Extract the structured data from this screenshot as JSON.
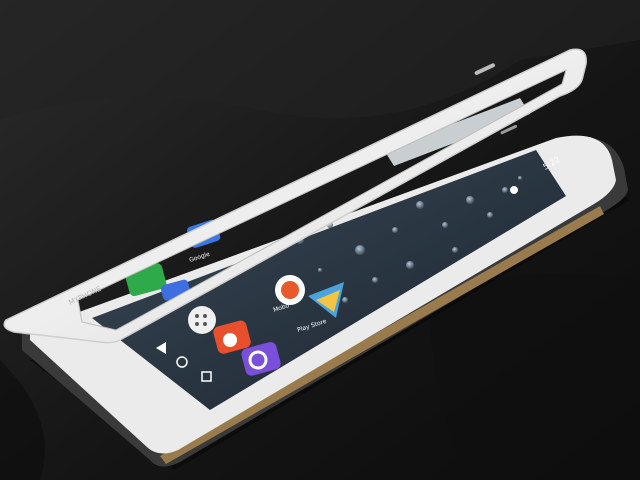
{
  "photo": {
    "subject": "smartphone with flip cover",
    "background_color": "#151515",
    "cover_color": "#f2f2f2",
    "body_color": "#e8e8e8",
    "bezel_color": "#2b2b2b",
    "screen_color": "#2a3440"
  },
  "screen": {
    "search_label": "Google",
    "status_time": "5:22",
    "apps": [
      {
        "name": "Google",
        "icon": "google-app-icon",
        "color": "#3b78e7"
      },
      {
        "name": "",
        "icon": "phone-icon",
        "color": "#2faa4a"
      },
      {
        "name": "",
        "icon": "contacts-icon",
        "color": "#3d6fe0"
      },
      {
        "name": "Mobo",
        "icon": "mobo-app-icon",
        "color": "#e85a2a"
      },
      {
        "name": "Play Store",
        "icon": "play-store-icon",
        "color": "#4aa3df"
      },
      {
        "name": "",
        "icon": "app-drawer-icon",
        "color": "#f0f0f0"
      },
      {
        "name": "",
        "icon": "chat-app-icon",
        "color": "#e8502d"
      },
      {
        "name": "",
        "icon": "swirl-app-icon",
        "color": "#7a4fd9"
      }
    ]
  },
  "cover": {
    "brand_text": "MYPHONE"
  }
}
